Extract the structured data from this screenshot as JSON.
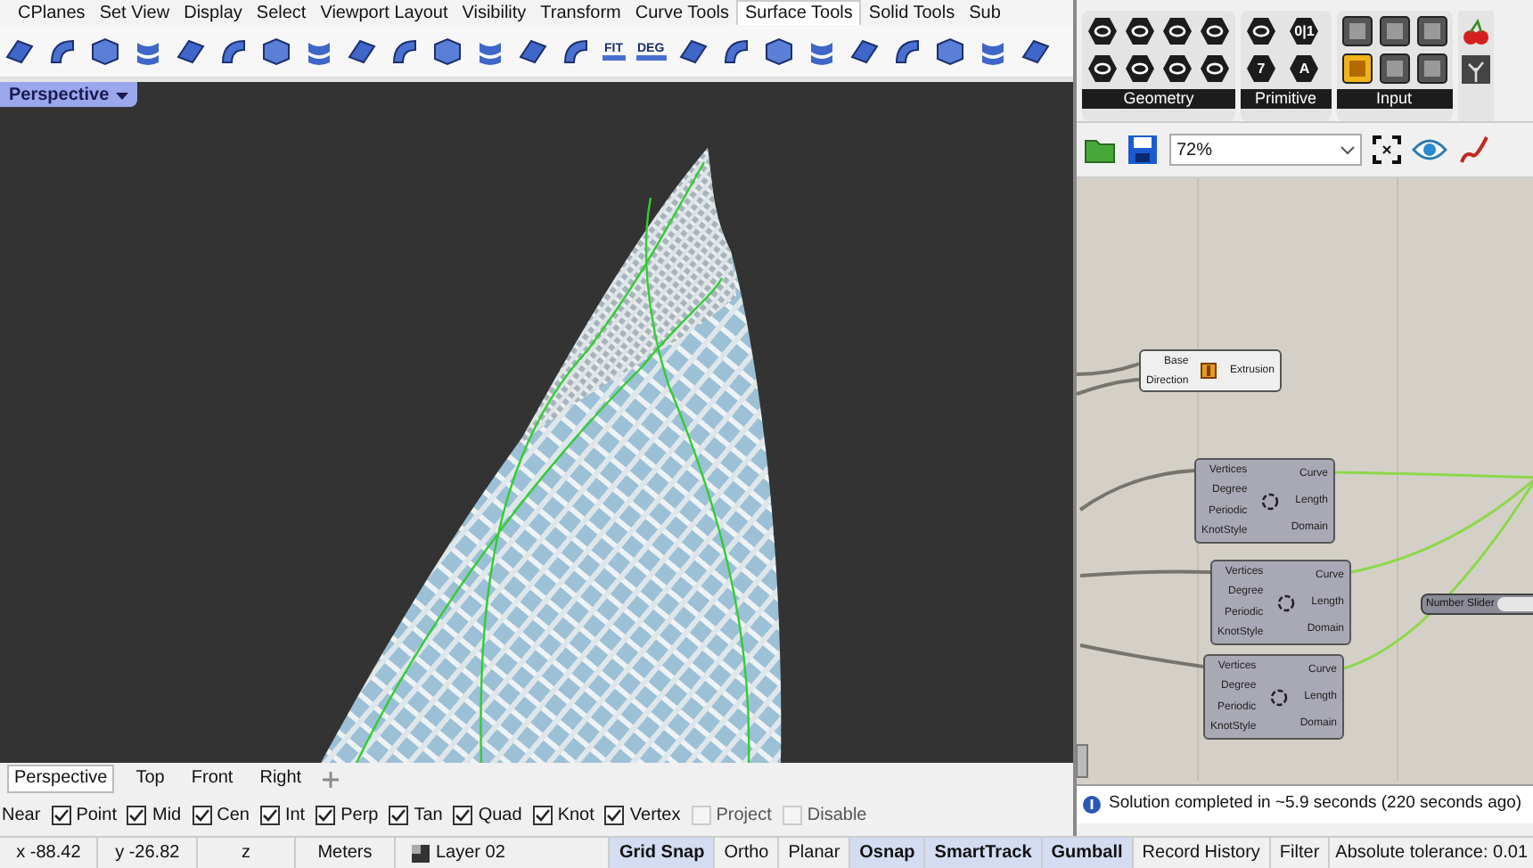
{
  "ribbon_tabs": [
    {
      "label": "CPlanes",
      "selected": false
    },
    {
      "label": "Set View",
      "selected": false
    },
    {
      "label": "Display",
      "selected": false
    },
    {
      "label": "Select",
      "selected": false
    },
    {
      "label": "Viewport Layout",
      "selected": false
    },
    {
      "label": "Visibility",
      "selected": false
    },
    {
      "label": "Transform",
      "selected": false
    },
    {
      "label": "Curve Tools",
      "selected": false
    },
    {
      "label": "Surface Tools",
      "selected": true
    },
    {
      "label": "Solid Tools",
      "selected": false
    },
    {
      "label": "Sub",
      "selected": false
    }
  ],
  "toolbar_labels": [
    "FIT",
    "DEG"
  ],
  "viewport": {
    "title": "Perspective"
  },
  "viewport_tabs": [
    {
      "label": "Perspective",
      "selected": true
    },
    {
      "label": "Top",
      "selected": false
    },
    {
      "label": "Front",
      "selected": false
    },
    {
      "label": "Right",
      "selected": false
    }
  ],
  "osnap_cut_label": "Near",
  "osnaps": [
    {
      "label": "Point",
      "checked": true
    },
    {
      "label": "Mid",
      "checked": true
    },
    {
      "label": "Cen",
      "checked": true
    },
    {
      "label": "Int",
      "checked": true
    },
    {
      "label": "Perp",
      "checked": true
    },
    {
      "label": "Tan",
      "checked": true
    },
    {
      "label": "Quad",
      "checked": true
    },
    {
      "label": "Knot",
      "checked": true
    },
    {
      "label": "Vertex",
      "checked": true
    },
    {
      "label": "Project",
      "checked": false
    },
    {
      "label": "Disable",
      "checked": false
    }
  ],
  "status_bar": {
    "fields": [
      "x -88.42",
      "y -26.82",
      "z",
      "Meters"
    ],
    "layer": "Layer 02",
    "toggles": [
      {
        "label": "Grid Snap",
        "on": true
      },
      {
        "label": "Ortho",
        "on": false
      },
      {
        "label": "Planar",
        "on": false
      },
      {
        "label": "Osnap",
        "on": true
      },
      {
        "label": "SmartTrack",
        "on": true
      },
      {
        "label": "Gumball",
        "on": true
      },
      {
        "label": "Record History",
        "on": false
      },
      {
        "label": "Filter",
        "on": false
      }
    ],
    "tolerance": "Absolute tolerance: 0.01"
  },
  "grasshopper": {
    "panels": [
      {
        "label": "Geometry"
      },
      {
        "label": "Primitive"
      },
      {
        "label": "Input"
      }
    ],
    "primitive_glyphs": [
      "0|1",
      "7",
      "A"
    ],
    "zoom": "72%",
    "nodes": [
      {
        "kind": "extrusion",
        "inputs": [
          "Base",
          "Direction"
        ],
        "outputs": [
          "Extrusion"
        ]
      },
      {
        "kind": "curve",
        "inputs": [
          "Vertices",
          "Degree",
          "Periodic",
          "KnotStyle"
        ],
        "outputs": [
          "Curve",
          "Length",
          "Domain"
        ]
      },
      {
        "kind": "curve",
        "inputs": [
          "Vertices",
          "Degree",
          "Periodic",
          "KnotStyle"
        ],
        "outputs": [
          "Curve",
          "Length",
          "Domain"
        ]
      },
      {
        "kind": "curve",
        "inputs": [
          "Vertices",
          "Degree",
          "Periodic",
          "KnotStyle"
        ],
        "outputs": [
          "Curve",
          "Length",
          "Domain"
        ]
      },
      {
        "kind": "slider",
        "label": "Number Slider"
      }
    ],
    "status": "Solution completed in ~5.9 seconds (220 seconds ago)"
  }
}
